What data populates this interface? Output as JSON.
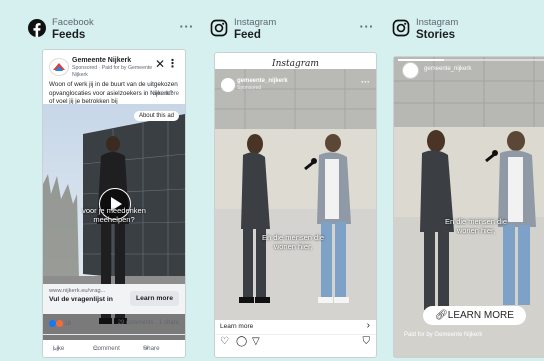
{
  "columns": {
    "facebook": {
      "platform": "Facebook",
      "placement": "Feeds"
    },
    "instagram_feed": {
      "platform": "Instagram",
      "placement": "Feed"
    },
    "instagram_stories": {
      "platform": "Instagram",
      "placement": "Stories"
    }
  },
  "menu_glyph": "···",
  "fb": {
    "page_name": "Gemeente Nijkerk",
    "sponsored_line": "Sponsored · Paid for by Gemeente Nijkerk",
    "body": "Woon of werk jij in de buurt van de uitgekozen opvanglocaties voor asielzoekers in Nijkerk? of voel jij je betrokken bij",
    "see_more": "· see more",
    "about_ad": "About this ad",
    "subtitle": "voor je meedenken meehelpen?",
    "url": "www.nijkerk.eu/vrag...",
    "headline": "Vul de vragenlijst in",
    "cta": "Learn more",
    "reaction_count": "18",
    "comments_shares": "29 comments · 1 share",
    "actions": [
      "Like",
      "Comment",
      "Share"
    ],
    "brand_color": "#1877f2"
  },
  "ig_feed": {
    "wordmark": "Instagram",
    "username": "gemeente_nijkerk",
    "sponsored": "Sponsored",
    "subtitle": "En die mensen die wonen hier,",
    "learn_more": "Learn more",
    "chevron": "›",
    "icons": [
      "heart-icon",
      "comment-icon",
      "send-icon",
      "bookmark-icon"
    ]
  },
  "ig_stories": {
    "username": "gemeente_nijkerk",
    "subtitle": "En die mensen die wonen hier,",
    "cta": "LEARN MORE",
    "paid_for": "Paid for by Gemeente Nijkerk"
  }
}
